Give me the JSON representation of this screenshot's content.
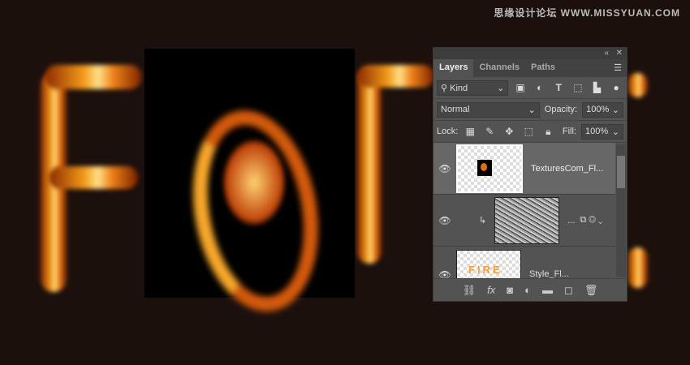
{
  "watermark": "思缘设计论坛 WWW.MISSYUAN.COM",
  "panel": {
    "tabs": [
      {
        "label": "Layers",
        "active": true
      },
      {
        "label": "Channels"
      },
      {
        "label": "Paths"
      }
    ],
    "filter": {
      "label": "Kind"
    },
    "blend_mode": "Normal",
    "opacity_label": "Opacity:",
    "opacity": "100%",
    "lock_label": "Lock:",
    "fill_label": "Fill:",
    "fill": "100%",
    "layers": [
      {
        "name": "TexturesCom_Fl...",
        "visible": true,
        "selected": true
      },
      {
        "name": "...",
        "visible": true,
        "clipped": true
      },
      {
        "name": "Style_Fl...",
        "visible": true
      }
    ]
  }
}
